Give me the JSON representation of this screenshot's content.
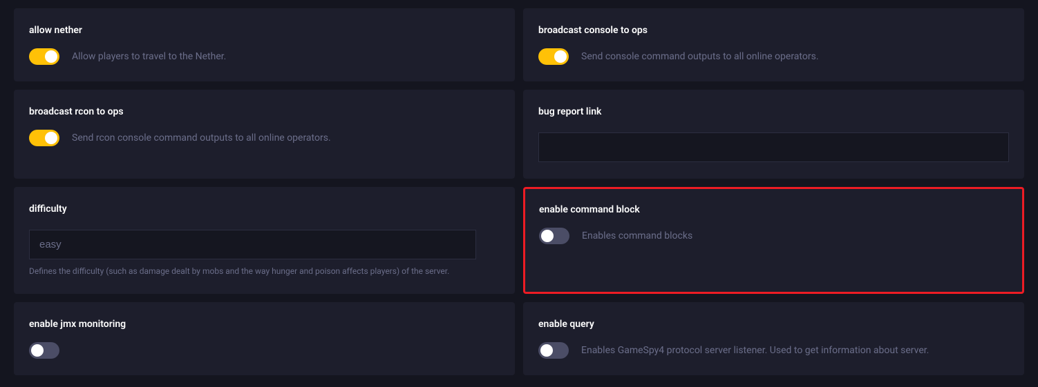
{
  "cards": {
    "allow_nether": {
      "title": "allow nether",
      "toggle_on": true,
      "desc": "Allow players to travel to the Nether."
    },
    "broadcast_console": {
      "title": "broadcast console to ops",
      "toggle_on": true,
      "desc": "Send console command outputs to all online operators."
    },
    "broadcast_rcon": {
      "title": "broadcast rcon to ops",
      "toggle_on": true,
      "desc": "Send rcon console command outputs to all online operators."
    },
    "bug_report": {
      "title": "bug report link",
      "value": ""
    },
    "difficulty": {
      "title": "difficulty",
      "value": "easy",
      "help": "Defines the difficulty (such as damage dealt by mobs and the way hunger and poison affects players) of the server."
    },
    "enable_command_block": {
      "title": "enable command block",
      "toggle_on": false,
      "desc": "Enables command blocks"
    },
    "enable_jmx": {
      "title": "enable jmx monitoring",
      "toggle_on": false,
      "desc": ""
    },
    "enable_query": {
      "title": "enable query",
      "toggle_on": false,
      "desc": "Enables GameSpy4 protocol server listener. Used to get information about server."
    }
  }
}
